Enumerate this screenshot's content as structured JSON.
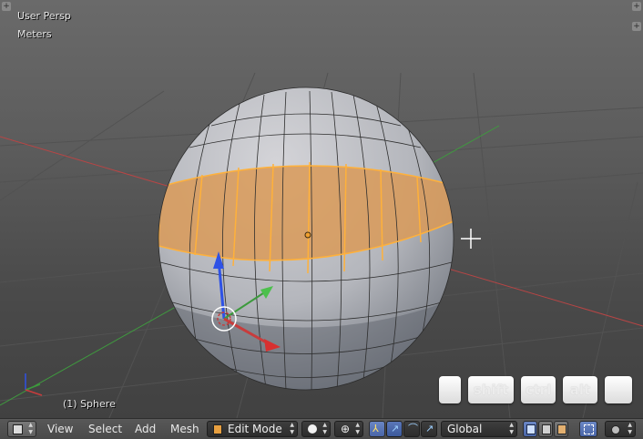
{
  "viewport": {
    "view_name": "User Persp",
    "units": "Meters",
    "object_label": "(1) Sphere",
    "corner_left_icon": "plus-icon",
    "corner_right_icon": "plus-icon"
  },
  "keys": [
    {
      "name": "key-blank-left",
      "label": ""
    },
    {
      "name": "key-shift",
      "label": "shift"
    },
    {
      "name": "key-ctrl",
      "label": "ctrl"
    },
    {
      "name": "key-alt",
      "label": "alt"
    },
    {
      "name": "key-blank-right",
      "label": ""
    }
  ],
  "header": {
    "editor_type_icon": "cube-icon",
    "menus": [
      "View",
      "Select",
      "Add",
      "Mesh"
    ],
    "mode": "Edit Mode",
    "shading_icon": "sphere-icon",
    "pivot_icon": "pivot-icon",
    "orientation": "Global",
    "select_modes": [
      "vertex-select-icon",
      "edge-select-icon",
      "face-select-icon"
    ],
    "proportional_icon": "proportional-icon"
  },
  "colors": {
    "accent": "#f0a030",
    "selection_fill": "#d99a58",
    "axis_x": "#c83c3c",
    "axis_y": "#3c9a3c",
    "axis_z": "#2e52e6"
  }
}
